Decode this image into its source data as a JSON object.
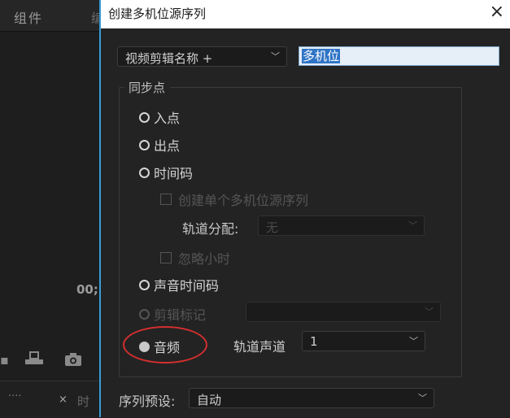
{
  "background": {
    "tab_label": "组件",
    "tab_cut_char": "编",
    "timecode": "00;",
    "bottom_close": "×",
    "bottom_text": "时",
    "bottom_dots": "...."
  },
  "dialog": {
    "title": "创建多机位源序列",
    "close_glyph": "×",
    "name_source_select": "视频剪辑名称 +",
    "name_value": "多机位",
    "sync_group_label": "同步点",
    "options": {
      "in_point": "入点",
      "out_point": "出点",
      "timecode": "时间码",
      "create_single": "创建单个多机位源序列",
      "track_assign_label": "轨道分配:",
      "track_assign_value": "无",
      "ignore_hours": "忽略小时",
      "audio_timecode": "声音时间码",
      "clip_marker": "剪辑标记",
      "audio": "音频",
      "track_channel_label": "轨道声道",
      "track_channel_value": "1"
    },
    "sequence_preset_label": "序列预设:",
    "sequence_preset_value": "自动"
  },
  "colors": {
    "accent_border": "#3a9bd9",
    "annotation": "#d42f2f",
    "selection": "#2f74c6"
  }
}
